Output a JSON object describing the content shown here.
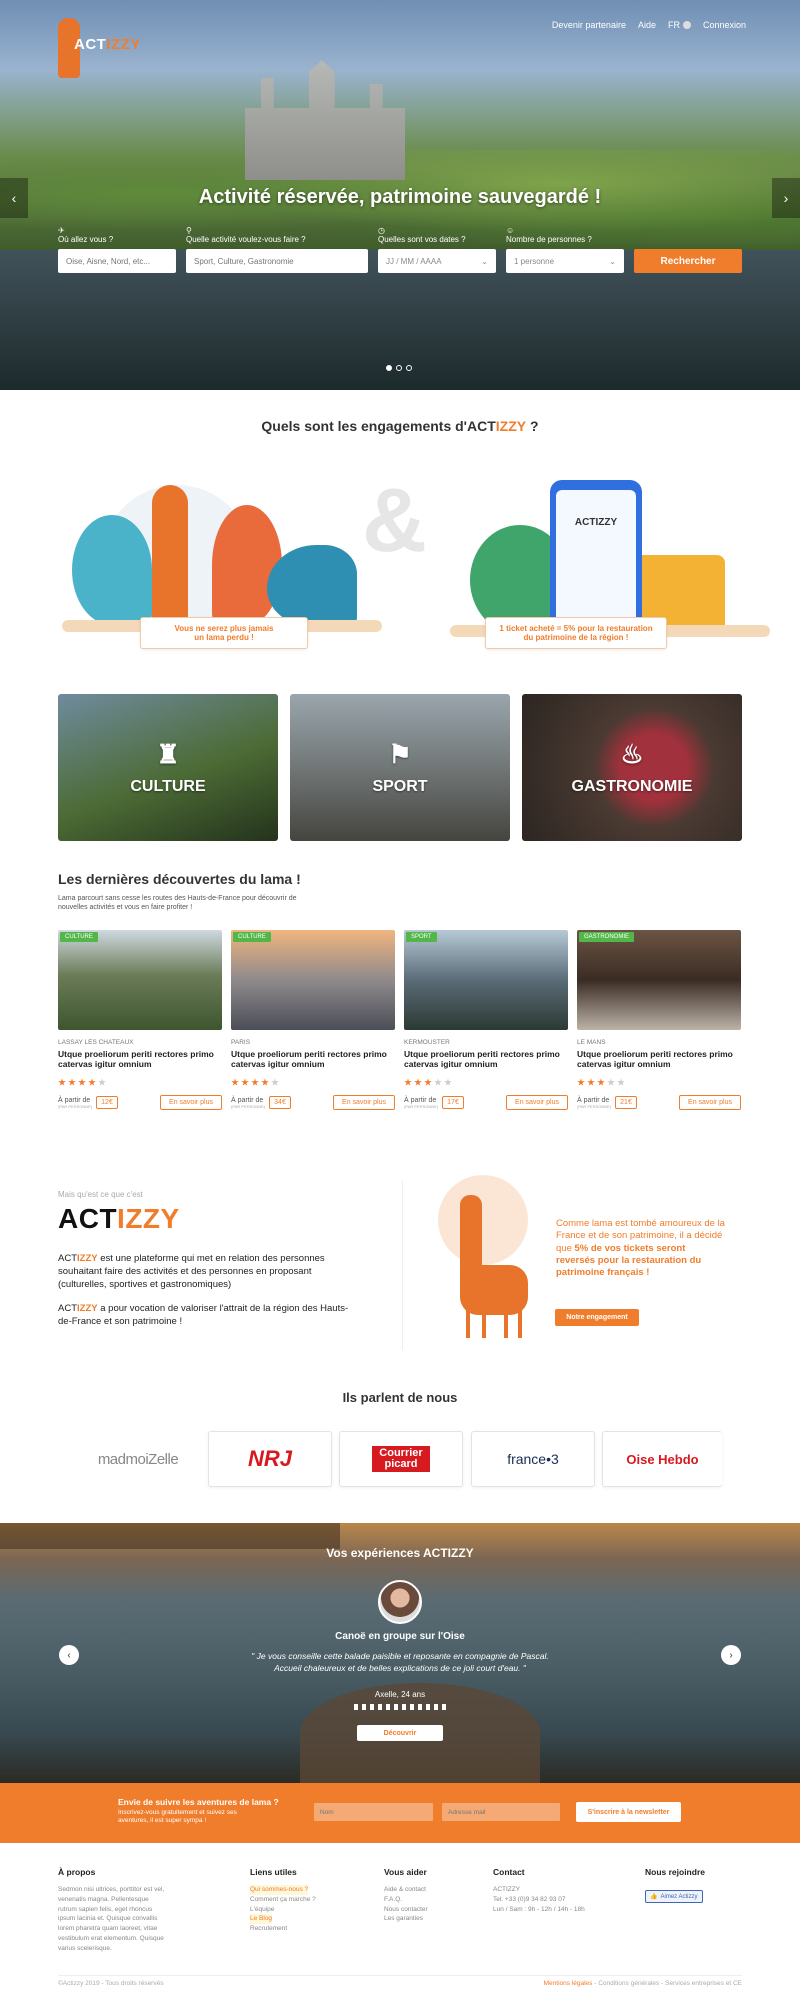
{
  "header": {
    "logo_word_a": "ACT",
    "logo_word_b": "IZZY",
    "nav": [
      "Devenir partenaire",
      "Aide"
    ],
    "lang": "FR",
    "login": "Connexion"
  },
  "hero": {
    "title": "Activité réservée, patrimoine sauvegardé !",
    "labels": [
      "Où allez vous ?",
      "Quelle activité voulez-vous faire ?",
      "Quelles sont vos dates ?",
      "Nombre de personnes ?"
    ],
    "where_placeholder": "Oise, Aisne, Nord, etc...",
    "activity_placeholder": "Sport, Culture, Gastronomie",
    "dates_value": "JJ / MM / AAAA",
    "persons_value": "1 personne",
    "search_label": "Rechercher"
  },
  "engage": {
    "title_a": "Quels sont les engagements d'ACT",
    "title_b": "IZZY",
    "title_c": " ?",
    "amp": "&",
    "left_line1": "Vous ne serez plus jamais",
    "left_line2": "un lama perdu !",
    "right_line1": "1 ticket acheté = 5% pour la restauration",
    "right_line2": "du patrimoine de la région !",
    "phone_brand": "ACTIZZY"
  },
  "categories": [
    "CULTURE",
    "SPORT",
    "GASTRONOMIE"
  ],
  "discoveries": {
    "title": "Les dernières découvertes du lama !",
    "subtitle": "Lama parcourt sans cesse les routes des Hauts-de-France pour découvrir de nouvelles activités et vous en faire profiter !",
    "cards": [
      {
        "tag": "CULTURE",
        "loc": "LASSAY LES CHATEAUX",
        "title": "Utque proeliorum periti rectores primo catervas igitur omnium",
        "from": "À partir de",
        "per": "(PAR PERSONNE)",
        "price": "12€",
        "more": "En savoir plus",
        "rating": 4
      },
      {
        "tag": "CULTURE",
        "loc": "PARIS",
        "title": "Utque proeliorum periti rectores primo catervas igitur omnium",
        "from": "À partir de",
        "per": "(PAR PERSONNE)",
        "price": "34€",
        "more": "En savoir plus",
        "rating": 4
      },
      {
        "tag": "SPORT",
        "loc": "KERMOUSTER",
        "title": "Utque proeliorum periti rectores primo catervas igitur omnium",
        "from": "À partir de",
        "per": "(PAR PERSONNE)",
        "price": "17€",
        "more": "En savoir plus",
        "rating": 3
      },
      {
        "tag": "GASTRONOMIE",
        "loc": "LE MANS",
        "title": "Utque proeliorum periti rectores primo catervas igitur omnium",
        "from": "À partir de",
        "per": "(PAR PERSONNE)",
        "price": "21€",
        "more": "En savoir plus",
        "rating": 3
      }
    ]
  },
  "about": {
    "kicker": "Mais qu'est ce que c'est",
    "brand_a": "ACT",
    "brand_b": "IZZY",
    "p1_a": "ACT",
    "p1_b": "IZZY",
    "p1_c": " est une plateforme qui met en relation des personnes souhaitant faire des activités et des personnes en proposant (culturelles, sportives et gastronomiques)",
    "p2_a": "ACT",
    "p2_b": "IZZY",
    "p2_c": " a pour vocation de valoriser l'attrait de la région des Hauts-de-France et son patrimoine !",
    "llama_text_a": "Comme lama est tombé amoureux de la France et de son patrimoine, il a décidé que ",
    "llama_text_b": "5% de vos tickets seront reversés pour la restauration du patrimoine français !",
    "commit_label": "Notre engagement"
  },
  "press": {
    "title": "Ils parlent de nous",
    "logos": [
      "madmoiZelle",
      "NRJ",
      "Courrier picard",
      "france•3",
      "Oise Hebdo"
    ]
  },
  "experiences": {
    "title": "Vos expériences ACTIZZY",
    "name": "Canoë en groupe sur l'Oise",
    "quote": "\" Je vous conseille cette balade paisible et reposante en compagnie de Pascal. Accueil chaleureux et de belles explications de ce joli court d'eau. \"",
    "author": "Axelle, 24 ans",
    "button": "Découvrir"
  },
  "newsletter": {
    "title": "Envie de suivre les aventures de lama ?",
    "sub": "Inscrivez-vous gratuitement et suivez ses aventures, il est super sympa !",
    "name_placeholder": "Nom",
    "email_placeholder": "Adresse mail",
    "button": "S'inscrire à la newsletter"
  },
  "footer": {
    "about_title": "À propos",
    "about_text": "Sedmon nisi ultrices, porttitor est vel, venenatis magna. Pellentesque rutrum sapien felis, eget rhoncus ipsum lacinia et. Quisque convallis lorem pharetra quam laoreet, vitae vestibulum erat elementum. Quisque varius scelerisque.",
    "links_title": "Liens utiles",
    "links": [
      "Qui sommes-nous ?",
      "Comment ça marche ?",
      "L'équipe",
      "Le Blog",
      "Recrutement"
    ],
    "help_title": "Vous aider",
    "help": [
      "Aide & contact",
      "F.A.Q.",
      "Nous contacter",
      "Les garanties"
    ],
    "contact_title": "Contact",
    "contact": [
      "ACTIZZY",
      "Tel. +33 (0)9 34 82 93 07",
      "Lun / Sam : 9h - 12h / 14h - 18h"
    ],
    "join_title": "Nous rejoindre",
    "like_label": "Aimez Actizzy",
    "copyright": "©Actizzy 2019 - Tous droits réservés",
    "legal_a": "Mentions légales",
    "legal_b": " - Conditions générales - Services entreprises et CE"
  },
  "colors": {
    "accent": "#f07d2c",
    "tag": "#52b748"
  }
}
